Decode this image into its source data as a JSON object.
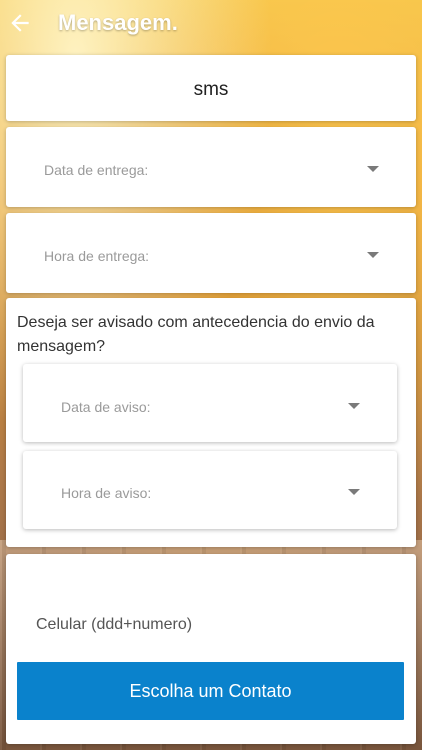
{
  "header": {
    "title": "Mensagem."
  },
  "message_type": {
    "value": "sms"
  },
  "delivery": {
    "date_label": "Data de entrega:",
    "time_label": "Hora de entrega:"
  },
  "notice": {
    "question": "Deseja ser avisado com antecedencia do envio da mensagem?",
    "date_label": "Data de aviso:",
    "time_label": "Hora de aviso:"
  },
  "contact": {
    "phone_placeholder": "Celular (ddd+numero)",
    "choose_button": "Escolha um Contato"
  },
  "colors": {
    "primary_button": "#0a82cc"
  }
}
